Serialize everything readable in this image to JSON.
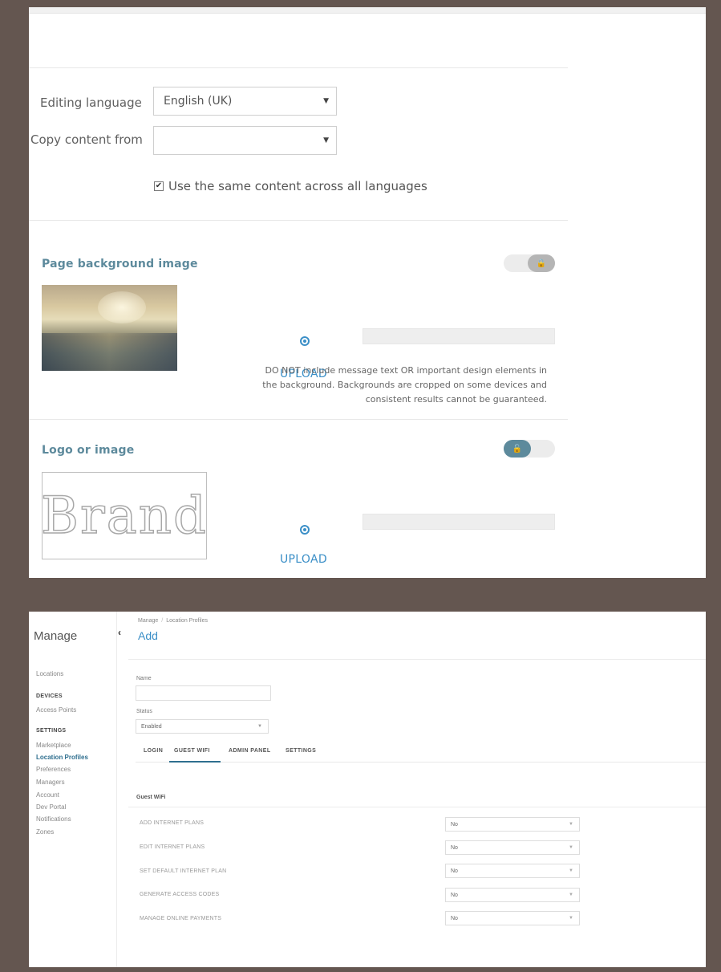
{
  "editor": {
    "editing_language_label": "Editing language",
    "editing_language_value": "English (UK)",
    "copy_content_label": "Copy content from",
    "copy_content_value": "",
    "same_content_checkbox_label": "Use the same content across all languages",
    "same_content_checked": true
  },
  "page_background": {
    "title": "Page background image",
    "upload_label": "UPLOAD",
    "notice": "DO NOT include message text OR important design elements in the background. Backgrounds are cropped on some devices and consistent results cannot be guaranteed."
  },
  "logo": {
    "title": "Logo or image",
    "brand_text": "Brand",
    "upload_label": "UPLOAD"
  },
  "manage": {
    "sidebar_title": "Manage",
    "items": [
      {
        "label": "Locations"
      },
      {
        "label": "DEVICES"
      },
      {
        "label": "Access Points"
      },
      {
        "label": "SETTINGS"
      },
      {
        "label": "Marketplace"
      },
      {
        "label": "Location Profiles"
      },
      {
        "label": "Preferences"
      },
      {
        "label": "Managers"
      },
      {
        "label": "Account"
      },
      {
        "label": "Dev Portal"
      },
      {
        "label": "Notifications"
      },
      {
        "label": "Zones"
      }
    ],
    "breadcrumb": [
      "Manage",
      "Location Profiles"
    ],
    "page_title": "Add",
    "name_label": "Name",
    "name_value": "",
    "status_label": "Status",
    "status_value": "Enabled",
    "tabs": [
      "LOGIN",
      "GUEST WIFI",
      "ADMIN PANEL",
      "SETTINGS"
    ],
    "active_tab": "GUEST WIFI",
    "section_title": "Guest WiFi",
    "rows": [
      {
        "label": "ADD INTERNET PLANS",
        "value": "No"
      },
      {
        "label": "EDIT INTERNET PLANS",
        "value": "No"
      },
      {
        "label": "SET DEFAULT INTERNET PLAN",
        "value": "No"
      },
      {
        "label": "GENERATE ACCESS CODES",
        "value": "No"
      },
      {
        "label": "MANAGE ONLINE PAYMENTS",
        "value": "No"
      }
    ]
  },
  "colors": {
    "accent": "#5d8a9c",
    "link": "#3b8fc7",
    "frame": "#645650"
  }
}
